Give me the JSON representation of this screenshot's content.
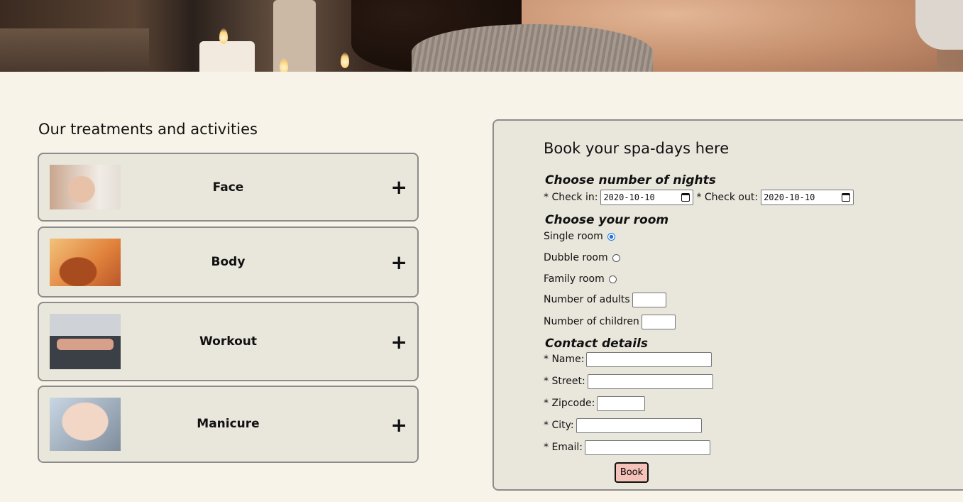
{
  "treatments": {
    "title": "Our treatments and activities",
    "items": [
      {
        "label": "Face",
        "toggle": "+",
        "image_icon": "face-photo"
      },
      {
        "label": "Body",
        "toggle": "+",
        "image_icon": "body-photo"
      },
      {
        "label": "Workout",
        "toggle": "+",
        "image_icon": "workout-photo"
      },
      {
        "label": "Manicure",
        "toggle": "+",
        "image_icon": "manicure-photo"
      }
    ]
  },
  "booking": {
    "title": "Book your spa-days here",
    "nights_heading": "Choose number of nights",
    "check_in_label": "* Check in:",
    "check_in_value": "2020-10-10",
    "check_out_label": "* Check out:",
    "check_out_value": "2020-10-10",
    "room_heading": "Choose your room",
    "rooms": [
      {
        "label": "Single room",
        "selected": true
      },
      {
        "label": "Dubble room",
        "selected": false
      },
      {
        "label": "Family room",
        "selected": false
      }
    ],
    "adults_label": "Number of adults",
    "children_label": "Number of children",
    "contact_heading": "Contact details",
    "name_label": "* Name:",
    "street_label": "* Street:",
    "zipcode_label": "* Zipcode:",
    "city_label": "* City:",
    "email_label": "* Email:",
    "book_button": "Book"
  },
  "colors": {
    "page_background": "#f8f3e8",
    "panel_background": "#e9e6dc",
    "button_background": "#f4c2b8"
  }
}
